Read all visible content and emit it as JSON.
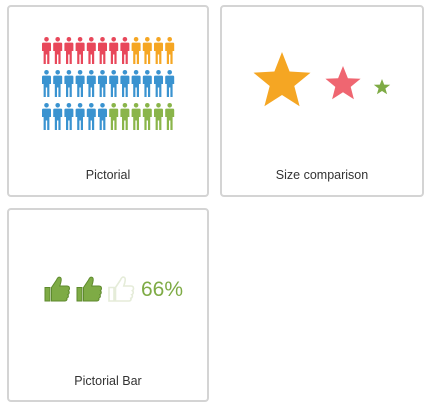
{
  "cards": [
    {
      "label": "Pictorial",
      "colors": [
        "#e8475a",
        "#f5a623",
        "#3a93d0",
        "#8ab54a"
      ],
      "rows": [
        {
          "color_counts": [
            [
              "#e8475a",
              8
            ],
            [
              "#f5a623",
              4
            ]
          ]
        },
        {
          "color_counts": [
            [
              "#3a93d0",
              12
            ]
          ]
        },
        {
          "color_counts": [
            [
              "#3a93d0",
              6
            ],
            [
              "#8ab54a",
              6
            ]
          ]
        }
      ]
    },
    {
      "label": "Size comparison",
      "stars": [
        {
          "color": "#f5a623",
          "relative_size": "large"
        },
        {
          "color": "#ef6671",
          "relative_size": "medium"
        },
        {
          "color": "#7eab45",
          "relative_size": "small"
        }
      ]
    },
    {
      "label": "Pictorial Bar",
      "filled_icon": "thumbs-up-icon",
      "filled_color": "#7eab45",
      "empty_color": "#e5ecd9",
      "thumbs": [
        true,
        true,
        false
      ],
      "percent_text": "66%",
      "percent_color": "#7eab45"
    }
  ]
}
